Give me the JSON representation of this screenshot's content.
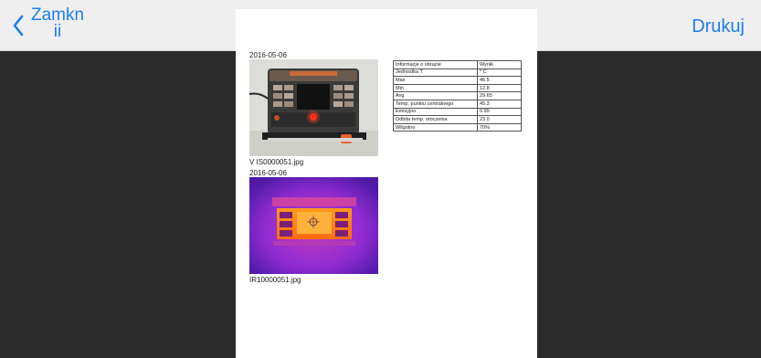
{
  "toolbar": {
    "back_label": "Zamkn ii",
    "print_label": "Drukuj"
  },
  "document": {
    "photo_date": "2016-05-06",
    "photo_caption": "V IS0000051.jpg",
    "thermal_date": "2016-05-06",
    "thermal_caption": "IR10000051.jpg",
    "table": {
      "headers": [
        "Informacje o obrazie",
        "Wynik"
      ],
      "rows": [
        [
          "Jednostka T",
          "° C"
        ],
        [
          "Max",
          "46.5"
        ],
        [
          "Min",
          "12.8"
        ],
        [
          "Avg",
          "29.65"
        ],
        [
          "Temp. punktu centralnego",
          "45.3"
        ],
        [
          "Emisyjno",
          "0.99"
        ],
        [
          "Odbita temp. otoczenia",
          "23.0"
        ],
        [
          "Wilgotno",
          "70%"
        ]
      ]
    }
  },
  "colors": {
    "accent": "#1e7ef0",
    "toolbar_bg": "#efefef",
    "backdrop": "#2b2b2b",
    "page": "#ffffff"
  },
  "icons": {
    "back": "chevron-left-icon"
  }
}
